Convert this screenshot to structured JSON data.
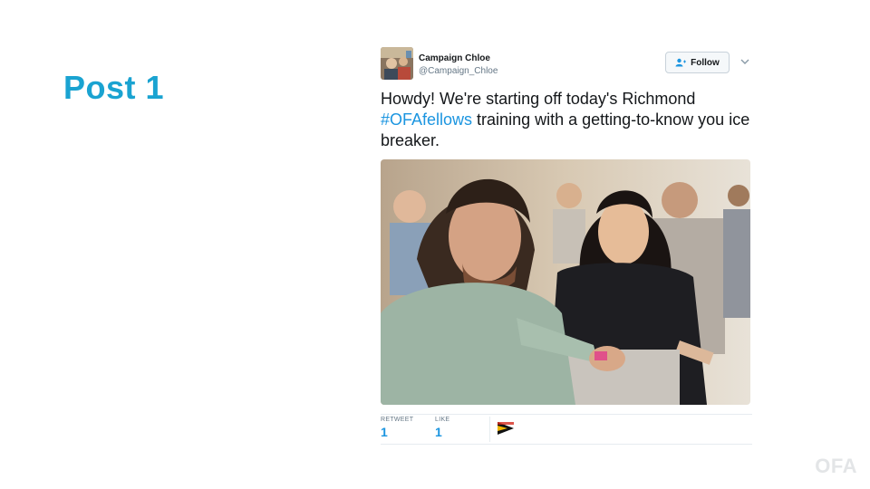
{
  "slide": {
    "title": "Post 1"
  },
  "tweet": {
    "author_name": "Campaign Chloe",
    "author_handle": "@Campaign_Chloe",
    "follow_label": "Follow",
    "text_before": "Howdy! We're starting off today's Richmond",
    "hashtag": "#OFAfellows",
    "text_after": " training with a getting-to-know you ice breaker.",
    "hashtag_color": "#1b95e0",
    "retweets_label": "RETWEET",
    "retweets_count": "1",
    "likes_label": "LIKE",
    "likes_count": "1"
  },
  "logo": {
    "text": "OFA"
  },
  "colors": {
    "title": "#1aa3d1",
    "link": "#1b95e0"
  }
}
